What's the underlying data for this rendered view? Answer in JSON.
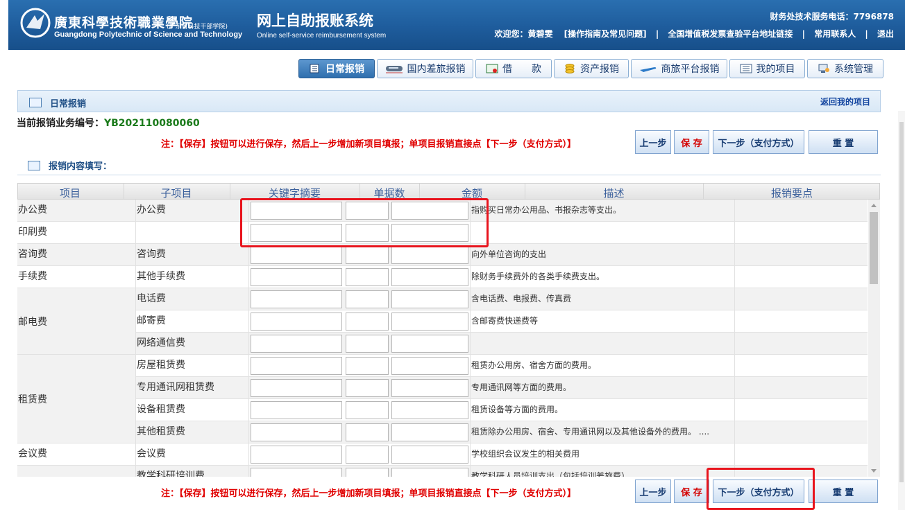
{
  "header": {
    "school_cn": "廣東科學技術職業學院",
    "school_cn_sub": "(广东省科技干部学院)",
    "school_en": "Guangdong Polytechnic of Science and Technology",
    "system_title": "网上自助报账系统",
    "system_en": "Online self-service reimbursement system",
    "hotline": "财务处技术服务电话：7796878",
    "welcome": "欢迎您：黄碧雯",
    "links": [
      "[操作指南及常见问题]",
      "全国增值税发票查验平台地址链接",
      "常用联系人",
      "退出"
    ],
    "colors": {
      "bar": "#1e5c9c",
      "text": "#ffffff"
    }
  },
  "nav": {
    "tabs": [
      {
        "label": "日常报销",
        "icon": "daily-icon",
        "active": true
      },
      {
        "label": "国内差旅报销",
        "icon": "train-icon",
        "active": false
      },
      {
        "label": "借　　款",
        "icon": "loan-icon",
        "active": false
      },
      {
        "label": "资产报销",
        "icon": "coins-icon",
        "active": false
      },
      {
        "label": "商旅平台报销",
        "icon": "plane-icon",
        "active": false
      },
      {
        "label": "我的项目",
        "icon": "list-icon",
        "active": false
      },
      {
        "label": "系统管理",
        "icon": "admin-icon",
        "active": false
      }
    ]
  },
  "panel": {
    "title": "日常报销",
    "back_link": "返回我的项目",
    "biz_no_label": "当前报销业务编号：",
    "biz_no_value": "YB202110080060",
    "notice": "注：【保存】按钮可以进行保存，然后上一步增加新项目填报；单项目报销直接点【下一步（支付方式）】",
    "buttons": {
      "prev": "上一步",
      "save": "保 存",
      "next": "下一步（支付方式）",
      "reset": "重 置"
    },
    "section_title": "报销内容填写："
  },
  "table": {
    "columns": [
      "项目",
      "子项目",
      "关键字摘要",
      "单据数",
      "金额",
      "描述",
      "报销要点"
    ],
    "rows": [
      {
        "item": "办公费",
        "sub": "办公费",
        "desc": "指购买日常办公用品、书报杂志等支出。",
        "grey": true
      },
      {
        "item": "印刷费",
        "sub": "",
        "desc": "",
        "grey": false
      },
      {
        "item": "咨询费",
        "sub": "咨询费",
        "desc": "向外单位咨询的支出",
        "grey": true
      },
      {
        "item": "手续费",
        "sub": "其他手续费",
        "desc": "除财务手续费外的各类手续费支出。",
        "grey": false
      },
      {
        "item": "",
        "sub": "电话费",
        "desc": "含电话费、电报费、传真费",
        "grey": true
      },
      {
        "item": "",
        "sub": "邮寄费",
        "desc": "含邮寄费快递费等",
        "grey": false
      },
      {
        "item": "",
        "sub": "网络通信费",
        "desc": "",
        "grey": true
      },
      {
        "item": "",
        "sub": "房屋租赁费",
        "desc": "租赁办公用房、宿舍方面的费用。",
        "grey": false
      },
      {
        "item": "",
        "sub": "专用通讯网租赁费",
        "desc": "专用通讯网等方面的费用。",
        "grey": true
      },
      {
        "item": "",
        "sub": "设备租赁费",
        "desc": "租赁设备等方面的费用。",
        "grey": false
      },
      {
        "item": "",
        "sub": "其他租赁费",
        "desc": "租赁除办公用房、宿舍、专用通讯网以及其他设备外的费用。 ....",
        "grey": true
      },
      {
        "item": "会议费",
        "sub": "会议费",
        "desc": "学校组织会议发生的相关费用",
        "grey": false
      },
      {
        "item": "",
        "sub": "教学科研培训费",
        "desc": "教学科研人员培训支出（包括培训差旅费）",
        "grey": true
      }
    ],
    "merged_items": [
      {
        "label": "邮电费"
      },
      {
        "label": "租赁费"
      }
    ]
  }
}
